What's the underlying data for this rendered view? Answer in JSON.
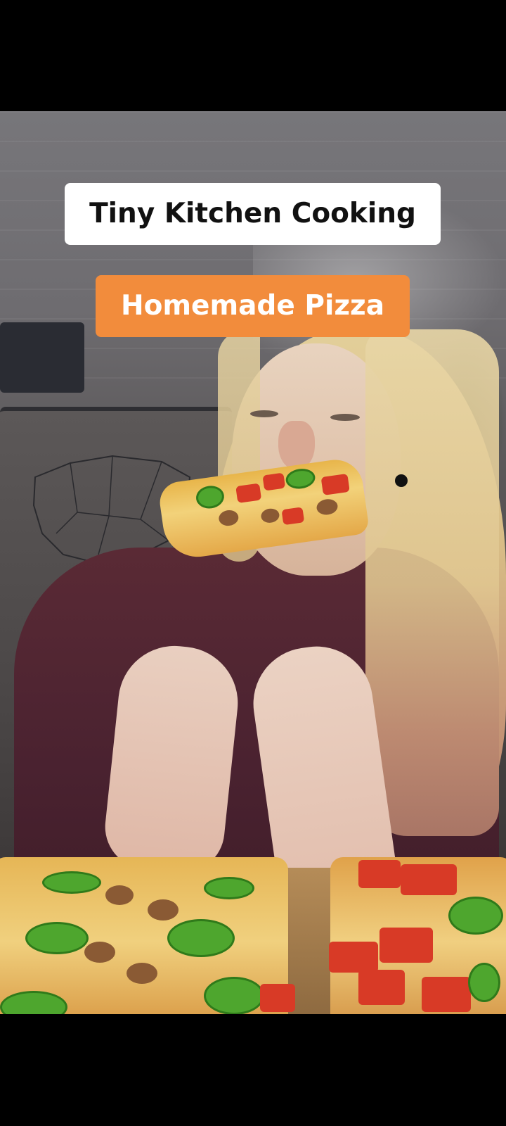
{
  "video": {
    "caption_primary": "Tiny Kitchen Cooking",
    "caption_secondary": "Homemade Pizza"
  },
  "colors": {
    "caption_primary_bg": "#ffffff",
    "caption_primary_text": "#111111",
    "caption_secondary_bg": "#f28c3c",
    "caption_secondary_text": "#ffffff",
    "letterbox": "#000000"
  }
}
